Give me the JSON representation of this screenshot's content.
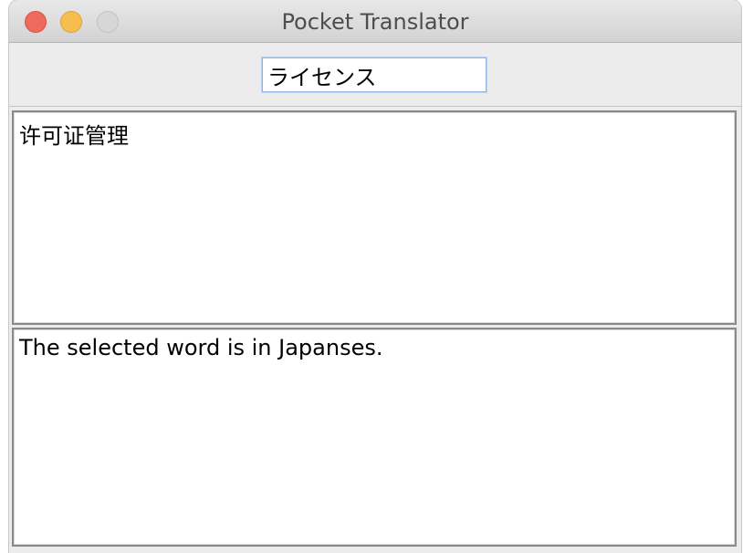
{
  "window": {
    "title": "Pocket Translator"
  },
  "search": {
    "value": "ライセンス"
  },
  "translation_panel": {
    "text": "许可证管理"
  },
  "info_panel": {
    "text": "The selected word is in Japanses."
  },
  "colors": {
    "close": "#ee6a5f",
    "minimize": "#f5be4f",
    "maximize_disabled": "#d7d7d7",
    "focus_ring": "#8fb6e6"
  }
}
